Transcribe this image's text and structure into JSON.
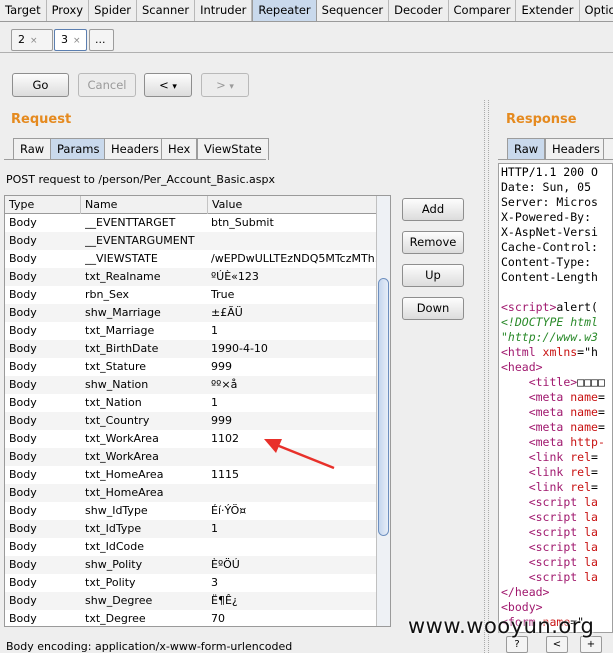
{
  "top_tabs": [
    "Target",
    "Proxy",
    "Spider",
    "Scanner",
    "Intruder",
    "Repeater",
    "Sequencer",
    "Decoder",
    "Comparer",
    "Extender",
    "Optio"
  ],
  "active_top_tab": "Repeater",
  "sub_tabs": [
    {
      "label": "2",
      "close": "×"
    },
    {
      "label": "3",
      "close": "×"
    },
    {
      "label": "..."
    }
  ],
  "toolbar": {
    "go": "Go",
    "cancel": "Cancel",
    "back": "<",
    "back_drop": "▾",
    "fwd": ">",
    "fwd_drop": "▾"
  },
  "request": {
    "title": "Request",
    "tabs": [
      "Raw",
      "Params",
      "Headers",
      "Hex",
      "ViewState"
    ],
    "active_tab": "Params",
    "request_line": "POST request to /person/Per_Account_Basic.aspx",
    "columns": [
      "Type",
      "Name",
      "Value"
    ],
    "rows": [
      [
        "Body",
        "__EVENTTARGET",
        "btn_Submit"
      ],
      [
        "Body",
        "__EVENTARGUMENT",
        ""
      ],
      [
        "Body",
        "__VIEWSTATE",
        "/wEPDwULLTEzNDQ5MTczMTh..."
      ],
      [
        "Body",
        "txt_Realname",
        "ºÚÈ«123"
      ],
      [
        "Body",
        "rbn_Sex",
        "True"
      ],
      [
        "Body",
        "shw_Marriage",
        "±£ÃÜ"
      ],
      [
        "Body",
        "txt_Marriage",
        "1"
      ],
      [
        "Body",
        "txt_BirthDate",
        "1990-4-10"
      ],
      [
        "Body",
        "txt_Stature",
        "999"
      ],
      [
        "Body",
        "shw_Nation",
        "ºº×å"
      ],
      [
        "Body",
        "txt_Nation",
        "1"
      ],
      [
        "Body",
        "txt_Country",
        "999"
      ],
      [
        "Body",
        "txt_WorkArea",
        "1102"
      ],
      [
        "Body",
        "txt_WorkArea",
        ""
      ],
      [
        "Body",
        "txt_HomeArea",
        "1115"
      ],
      [
        "Body",
        "txt_HomeArea",
        ""
      ],
      [
        "Body",
        "shw_IdType",
        "Éí·ÝÖ¤"
      ],
      [
        "Body",
        "txt_IdType",
        "1"
      ],
      [
        "Body",
        "txt_IdCode",
        ""
      ],
      [
        "Body",
        "shw_Polity",
        "ÈºÖÚ"
      ],
      [
        "Body",
        "txt_Polity",
        "3"
      ],
      [
        "Body",
        "shw_Degree",
        "Ë¶Ê¿"
      ],
      [
        "Body",
        "txt_Degree",
        "70"
      ]
    ],
    "side_buttons": [
      "Add",
      "Remove",
      "Up",
      "Down"
    ],
    "encoding": "Body encoding:  application/x-www-form-urlencoded"
  },
  "response": {
    "title": "Response",
    "tabs": [
      "Raw",
      "Headers"
    ],
    "active_tab": "Raw",
    "headers": [
      "HTTP/1.1 200 O",
      "Date: Sun, 05 ",
      "Server: Micros",
      "X-Powered-By: ",
      "X-AspNet-Versi",
      "Cache-Control:",
      "Content-Type: ",
      "Content-Length"
    ],
    "html_lines": [
      {
        "indent": "",
        "parts": [
          [
            "tag",
            "<script>"
          ],
          [
            "plain",
            "alert("
          ]
        ]
      },
      {
        "indent": "",
        "parts": [
          [
            "str",
            "<!DOCTYPE html"
          ]
        ]
      },
      {
        "indent": "",
        "parts": [
          [
            "str",
            "\"http://www.w3"
          ]
        ]
      },
      {
        "indent": "",
        "parts": [
          [
            "tag",
            "<html "
          ],
          [
            "attr",
            "xmlns"
          ],
          [
            "plain",
            "=\"h"
          ]
        ]
      },
      {
        "indent": "",
        "parts": [
          [
            "tag",
            "<head>"
          ]
        ]
      },
      {
        "indent": "    ",
        "parts": [
          [
            "tag",
            "<title>"
          ],
          [
            "plain",
            "□□□□"
          ]
        ]
      },
      {
        "indent": "    ",
        "parts": [
          [
            "tag",
            "<meta "
          ],
          [
            "attr",
            "name"
          ],
          [
            "plain",
            "="
          ]
        ]
      },
      {
        "indent": "    ",
        "parts": [
          [
            "tag",
            "<meta "
          ],
          [
            "attr",
            "name"
          ],
          [
            "plain",
            "="
          ]
        ]
      },
      {
        "indent": "    ",
        "parts": [
          [
            "tag",
            "<meta "
          ],
          [
            "attr",
            "name"
          ],
          [
            "plain",
            "="
          ]
        ]
      },
      {
        "indent": "    ",
        "parts": [
          [
            "tag",
            "<meta "
          ],
          [
            "attr",
            "http-"
          ]
        ]
      },
      {
        "indent": "    ",
        "parts": [
          [
            "tag",
            "<link "
          ],
          [
            "attr",
            "rel"
          ],
          [
            "plain",
            "="
          ]
        ]
      },
      {
        "indent": "    ",
        "parts": [
          [
            "tag",
            "<link "
          ],
          [
            "attr",
            "rel"
          ],
          [
            "plain",
            "="
          ]
        ]
      },
      {
        "indent": "    ",
        "parts": [
          [
            "tag",
            "<link "
          ],
          [
            "attr",
            "rel"
          ],
          [
            "plain",
            "="
          ]
        ]
      },
      {
        "indent": "    ",
        "parts": [
          [
            "tag",
            "<script "
          ],
          [
            "attr",
            "la"
          ]
        ]
      },
      {
        "indent": "    ",
        "parts": [
          [
            "tag",
            "<script "
          ],
          [
            "attr",
            "la"
          ]
        ]
      },
      {
        "indent": "    ",
        "parts": [
          [
            "tag",
            "<script "
          ],
          [
            "attr",
            "la"
          ]
        ]
      },
      {
        "indent": "    ",
        "parts": [
          [
            "tag",
            "<script "
          ],
          [
            "attr",
            "la"
          ]
        ]
      },
      {
        "indent": "    ",
        "parts": [
          [
            "tag",
            "<script "
          ],
          [
            "attr",
            "la"
          ]
        ]
      },
      {
        "indent": "    ",
        "parts": [
          [
            "tag",
            "<script "
          ],
          [
            "attr",
            "la"
          ]
        ]
      },
      {
        "indent": "",
        "parts": [
          [
            "tag",
            "</head>"
          ]
        ]
      },
      {
        "indent": "",
        "parts": [
          [
            "tag",
            "<body>"
          ]
        ]
      },
      {
        "indent": "",
        "parts": [
          [
            "tag",
            "<form "
          ],
          [
            "attr",
            "name"
          ],
          [
            "plain",
            "=\""
          ]
        ]
      }
    ],
    "bottom_buttons": [
      "?",
      "<",
      "+"
    ]
  },
  "watermark": "www.wooyun.org",
  "colors": {
    "accent_orange": "#e58a1f",
    "active_tab": "#c9d9ec",
    "arrow_red": "#e8302a"
  }
}
